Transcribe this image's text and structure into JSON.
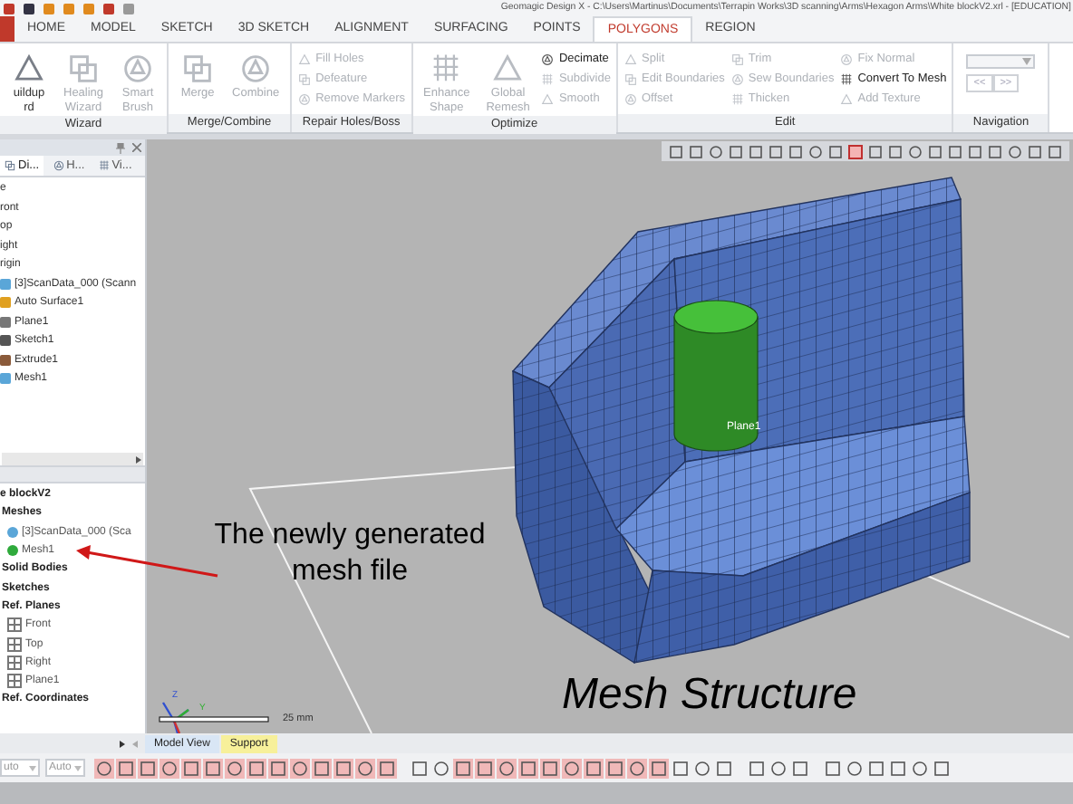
{
  "title_bar": {
    "title": "Geomagic Design X - C:\\Users\\Martinus\\Documents\\Terrapin Works\\3D scanning\\Arms\\Hexagon Arms\\White blockV2.xrl - [EDUCATION]"
  },
  "ribbon_tabs": [
    {
      "label": "HOME",
      "selected": false
    },
    {
      "label": "MODEL",
      "selected": false
    },
    {
      "label": "SKETCH",
      "selected": false
    },
    {
      "label": "3D SKETCH",
      "selected": false
    },
    {
      "label": "ALIGNMENT",
      "selected": false
    },
    {
      "label": "SURFACING",
      "selected": false
    },
    {
      "label": "POINTS",
      "selected": false
    },
    {
      "label": "POLYGONS",
      "selected": true
    },
    {
      "label": "REGION",
      "selected": false
    }
  ],
  "ribbon_groups": [
    {
      "title": "Wizard",
      "columns": [
        {
          "kind": "large",
          "lines": [
            "uildup",
            "rd"
          ],
          "disabled": false
        },
        {
          "kind": "large",
          "lines": [
            "Healing",
            "Wizard"
          ],
          "disabled": true
        },
        {
          "kind": "large",
          "lines": [
            "Smart",
            "Brush"
          ],
          "disabled": true
        }
      ]
    },
    {
      "title": "Merge/Combine",
      "columns": [
        {
          "kind": "large",
          "lines": [
            "Merge"
          ],
          "disabled": true
        },
        {
          "kind": "large",
          "lines": [
            "Combine"
          ],
          "disabled": true
        }
      ]
    },
    {
      "title": "Repair Holes/Boss",
      "columns": [
        {
          "kind": "stack",
          "items": [
            {
              "label": "Fill Holes",
              "disabled": true
            },
            {
              "label": "Defeature",
              "disabled": true
            },
            {
              "label": "Remove Markers",
              "disabled": true
            }
          ]
        }
      ]
    },
    {
      "title": "Optimize",
      "columns": [
        {
          "kind": "large",
          "lines": [
            "Enhance",
            "Shape"
          ],
          "disabled": true
        },
        {
          "kind": "large",
          "lines": [
            "Global",
            "Remesh"
          ],
          "disabled": true
        },
        {
          "kind": "stack",
          "items": [
            {
              "label": "Decimate",
              "disabled": false
            },
            {
              "label": "Subdivide",
              "disabled": true
            },
            {
              "label": "Smooth",
              "disabled": true
            }
          ]
        }
      ]
    },
    {
      "title": "Edit",
      "columns": [
        {
          "kind": "stack",
          "items": [
            {
              "label": "Split",
              "disabled": true
            },
            {
              "label": "Edit Boundaries",
              "disabled": true
            },
            {
              "label": "Offset",
              "disabled": true
            }
          ]
        },
        {
          "kind": "stack",
          "items": [
            {
              "label": "Trim",
              "disabled": true
            },
            {
              "label": "Sew Boundaries",
              "disabled": true
            },
            {
              "label": "Thicken",
              "disabled": true
            }
          ]
        },
        {
          "kind": "stack",
          "items": [
            {
              "label": "Fix Normal",
              "disabled": true
            },
            {
              "label": "Convert To Mesh",
              "disabled": false
            },
            {
              "label": "Add Texture",
              "disabled": true
            }
          ]
        }
      ]
    },
    {
      "title": "Navigation",
      "columns": [
        {
          "kind": "nav",
          "buttons": [
            "<<",
            ">>"
          ]
        }
      ]
    }
  ],
  "panel_tabs": [
    {
      "label": "Di...",
      "selected": true
    },
    {
      "label": "H...",
      "selected": false
    },
    {
      "label": "Vi...",
      "selected": false
    }
  ],
  "feature_tree": [
    {
      "label": "e",
      "kind": "cut"
    },
    {
      "label": "ront",
      "kind": "cut"
    },
    {
      "label": "op",
      "kind": "cut"
    },
    {
      "label": "ight",
      "kind": "cut"
    },
    {
      "label": "rigin",
      "kind": "cut"
    },
    {
      "label": "[3]ScanData_000 (Scann",
      "kind": "mesh"
    },
    {
      "label": "Auto Surface1",
      "kind": "surface"
    },
    {
      "label": "Plane1",
      "kind": "plane"
    },
    {
      "label": "Sketch1",
      "kind": "sketch"
    },
    {
      "label": "Extrude1",
      "kind": "extrude"
    },
    {
      "label": "Mesh1",
      "kind": "mesh"
    }
  ],
  "model_tree": {
    "label": "e blockV2",
    "children": [
      {
        "label": "Meshes",
        "children": [
          {
            "label": "[3]ScanData_000 (Sca",
            "color": "#5aa6d8"
          },
          {
            "label": "Mesh1",
            "color": "#2faa3c"
          }
        ]
      },
      {
        "label": "Solid Bodies"
      },
      {
        "label": "Sketches"
      },
      {
        "label": "Ref. Planes",
        "children": [
          {
            "label": "Front"
          },
          {
            "label": "Top"
          },
          {
            "label": "Right"
          },
          {
            "label": "Plane1"
          }
        ]
      },
      {
        "label": "Ref. Coordinates"
      }
    ]
  },
  "viewport": {
    "plane_label": "Plane1",
    "axis_labels": [
      "Z",
      "Y"
    ],
    "scale": "25 mm",
    "caption": "Mesh Structure"
  },
  "callout": {
    "text": "The newly generated mesh file"
  },
  "view_tabs": [
    {
      "label": "Model View",
      "color": "#d9e6f5"
    },
    {
      "label": "Support",
      "color": "#f7f09a"
    }
  ],
  "bottom_dropdowns": [
    {
      "value": "uto"
    },
    {
      "value": "Auto"
    }
  ]
}
